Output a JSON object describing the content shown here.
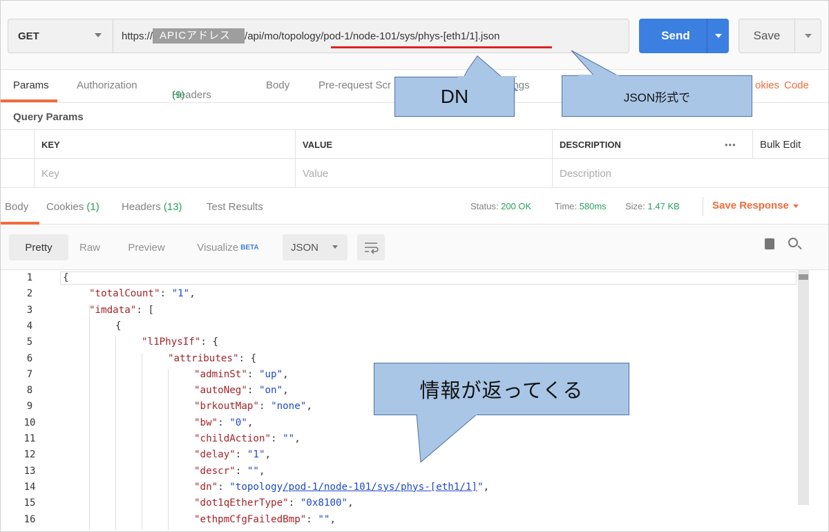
{
  "request": {
    "method": "GET",
    "url_prefix": "https://",
    "url_redacted": "APICアドレス",
    "url_api": "/api/mo/",
    "url_dn": "topology/pod-1/node-101/sys/phys-[eth1/1]",
    "url_suffix": ".json",
    "send_label": "Send",
    "save_label": "Save"
  },
  "request_tabs": {
    "params": "Params",
    "authorization": "Authorization",
    "headers": "Headers",
    "headers_count": "(9)",
    "body": "Body",
    "prerequest": "Pre-request Scr",
    "settings": "ings",
    "cookies": "okies",
    "code": "Code"
  },
  "query_params": {
    "title": "Query Params",
    "headers": [
      "KEY",
      "VALUE",
      "DESCRIPTION"
    ],
    "bulk_edit": "Bulk Edit",
    "more": "•••",
    "placeholders": [
      "Key",
      "Value",
      "Description"
    ]
  },
  "response_tabs": {
    "body": "Body",
    "cookies": "Cookies",
    "cookies_count": "(1)",
    "headers": "Headers",
    "headers_count": "(13)",
    "test_results": "Test Results"
  },
  "status": {
    "status_label": "Status:",
    "status_value": "200 OK",
    "time_label": "Time:",
    "time_value": "580ms",
    "size_label": "Size:",
    "size_value": "1.47 KB",
    "save_response": "Save Response"
  },
  "view": {
    "pretty": "Pretty",
    "raw": "Raw",
    "preview": "Preview",
    "visualize": "Visualize",
    "beta": "BETA",
    "format": "JSON"
  },
  "code_lines": [
    {
      "n": "1",
      "indent": 0,
      "parts": [
        [
          "p",
          "{"
        ]
      ]
    },
    {
      "n": "2",
      "indent": 1,
      "parts": [
        [
          "k",
          "\"totalCount\""
        ],
        [
          "p",
          ": "
        ],
        [
          "s",
          "\"1\""
        ],
        [
          "p",
          ","
        ]
      ]
    },
    {
      "n": "3",
      "indent": 1,
      "parts": [
        [
          "k",
          "\"imdata\""
        ],
        [
          "p",
          ": ["
        ]
      ]
    },
    {
      "n": "4",
      "indent": 2,
      "parts": [
        [
          "p",
          "{"
        ]
      ]
    },
    {
      "n": "5",
      "indent": 3,
      "parts": [
        [
          "k",
          "\"l1PhysIf\""
        ],
        [
          "p",
          ": {"
        ]
      ]
    },
    {
      "n": "6",
      "indent": 4,
      "parts": [
        [
          "k",
          "\"attributes\""
        ],
        [
          "p",
          ": {"
        ]
      ]
    },
    {
      "n": "7",
      "indent": 5,
      "parts": [
        [
          "k",
          "\"adminSt\""
        ],
        [
          "p",
          ": "
        ],
        [
          "s",
          "\"up\""
        ],
        [
          "p",
          ","
        ]
      ]
    },
    {
      "n": "8",
      "indent": 5,
      "parts": [
        [
          "k",
          "\"autoNeg\""
        ],
        [
          "p",
          ": "
        ],
        [
          "s",
          "\"on\""
        ],
        [
          "p",
          ","
        ]
      ]
    },
    {
      "n": "9",
      "indent": 5,
      "parts": [
        [
          "k",
          "\"brkoutMap\""
        ],
        [
          "p",
          ": "
        ],
        [
          "s",
          "\"none\""
        ],
        [
          "p",
          ","
        ]
      ]
    },
    {
      "n": "10",
      "indent": 5,
      "parts": [
        [
          "k",
          "\"bw\""
        ],
        [
          "p",
          ": "
        ],
        [
          "s",
          "\"0\""
        ],
        [
          "p",
          ","
        ]
      ]
    },
    {
      "n": "11",
      "indent": 5,
      "parts": [
        [
          "k",
          "\"childAction\""
        ],
        [
          "p",
          ": "
        ],
        [
          "s",
          "\"\""
        ],
        [
          "p",
          ","
        ]
      ]
    },
    {
      "n": "12",
      "indent": 5,
      "parts": [
        [
          "k",
          "\"delay\""
        ],
        [
          "p",
          ": "
        ],
        [
          "s",
          "\"1\""
        ],
        [
          "p",
          ","
        ]
      ]
    },
    {
      "n": "13",
      "indent": 5,
      "parts": [
        [
          "k",
          "\"descr\""
        ],
        [
          "p",
          ": "
        ],
        [
          "s",
          "\"\""
        ],
        [
          "p",
          ","
        ]
      ]
    },
    {
      "n": "14",
      "indent": 5,
      "parts": [
        [
          "k",
          "\"dn\""
        ],
        [
          "p",
          ": "
        ],
        [
          "s",
          "\"topology"
        ],
        [
          "L",
          "/pod-1/node-101/sys/phys-[eth1/1]"
        ],
        [
          "s",
          "\""
        ],
        [
          "p",
          ","
        ]
      ]
    },
    {
      "n": "15",
      "indent": 5,
      "parts": [
        [
          "k",
          "\"dot1qEtherType\""
        ],
        [
          "p",
          ": "
        ],
        [
          "s",
          "\"0x8100\""
        ],
        [
          "p",
          ","
        ]
      ]
    },
    {
      "n": "16",
      "indent": 5,
      "parts": [
        [
          "k",
          "\"ethpmCfgFailedBmp\""
        ],
        [
          "p",
          ": "
        ],
        [
          "s",
          "\"\""
        ],
        [
          "p",
          ","
        ]
      ]
    }
  ],
  "callouts": {
    "dn": "DN",
    "json": "JSON形式で",
    "info": "情報が返ってくる"
  }
}
